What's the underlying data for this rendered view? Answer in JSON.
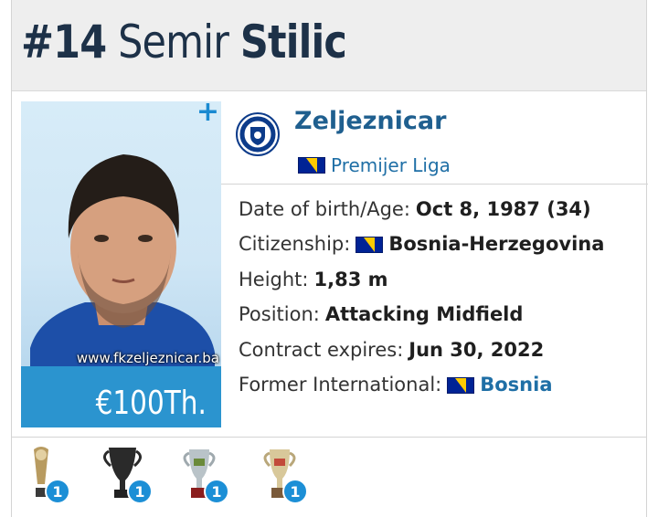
{
  "header": {
    "number": "#14",
    "first_name": "Semir",
    "last_name": "Stilic"
  },
  "photo": {
    "caption": "www.fkzeljeznicar.ba",
    "plus_label": "+"
  },
  "market_value": "€100Th.",
  "club": {
    "name": "Zeljeznicar",
    "league": "Premijer Liga",
    "league_flag": "bosnia-flag-icon"
  },
  "info": [
    {
      "label": "Date of birth/Age:",
      "value": "Oct 8, 1987 (34)",
      "flag": false,
      "link": false
    },
    {
      "label": "Citizenship:",
      "value": "Bosnia-Herzegovina",
      "flag": true,
      "link": false
    },
    {
      "label": "Height:",
      "value": "1,83 m",
      "flag": false,
      "link": false
    },
    {
      "label": "Position:",
      "value": "Attacking Midfield",
      "flag": false,
      "link": false
    },
    {
      "label": "Contract expires:",
      "value": "Jun 30, 2022",
      "flag": false,
      "link": false
    },
    {
      "label": "Former International:",
      "value": "Bosnia",
      "flag": true,
      "link": true
    }
  ],
  "trophies": [
    {
      "icon": "trophy-small-icon",
      "count": "1"
    },
    {
      "icon": "trophy-cup-icon",
      "count": "1"
    },
    {
      "icon": "trophy-silver-cup-icon",
      "count": "1"
    },
    {
      "icon": "trophy-gold-cup-icon",
      "count": "1"
    }
  ],
  "colors": {
    "accent": "#2b94cf",
    "link": "#1f6fa6",
    "title": "#1d3148",
    "header_bg": "#eeeeee"
  }
}
